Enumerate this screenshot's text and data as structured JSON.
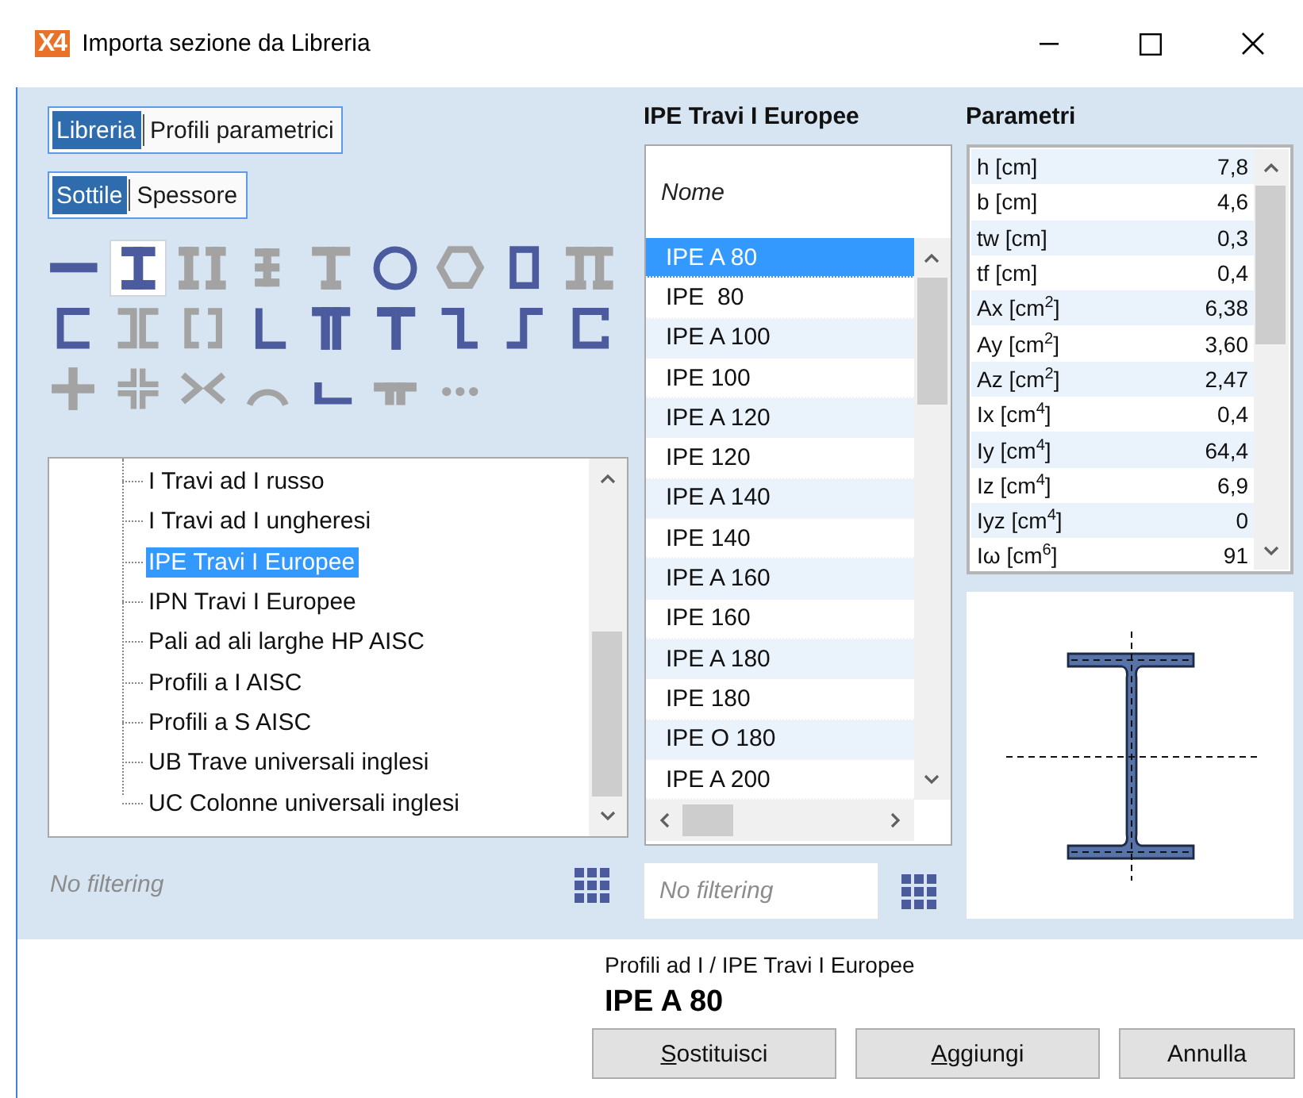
{
  "window": {
    "logo": "X4",
    "title": "Importa sezione da Libreria"
  },
  "source_tabs": [
    {
      "label": "Libreria",
      "selected": true
    },
    {
      "label": "Profili parametrici",
      "selected": false
    }
  ],
  "thickness_tabs": [
    {
      "label": "Sottile",
      "selected": true
    },
    {
      "label": "Spessore",
      "selected": false
    }
  ],
  "shapes": [
    {
      "kind": "plate",
      "disabled": false,
      "selected": false
    },
    {
      "kind": "i-beam",
      "disabled": false,
      "selected": true
    },
    {
      "kind": "double-i",
      "disabled": true,
      "selected": false
    },
    {
      "kind": "stiffened-i",
      "disabled": true,
      "selected": false
    },
    {
      "kind": "narrow-i",
      "disabled": true,
      "selected": false
    },
    {
      "kind": "circle",
      "disabled": false,
      "selected": false
    },
    {
      "kind": "hexagon",
      "disabled": true,
      "selected": false
    },
    {
      "kind": "box",
      "disabled": false,
      "selected": false
    },
    {
      "kind": "pi",
      "disabled": true,
      "selected": false
    },
    {
      "kind": "channel",
      "disabled": false,
      "selected": false
    },
    {
      "kind": "back-channels",
      "disabled": true,
      "selected": false
    },
    {
      "kind": "split-box",
      "disabled": true,
      "selected": false
    },
    {
      "kind": "angle",
      "disabled": false,
      "selected": false
    },
    {
      "kind": "double-tee",
      "disabled": false,
      "selected": false
    },
    {
      "kind": "tee",
      "disabled": false,
      "selected": false
    },
    {
      "kind": "zed",
      "disabled": false,
      "selected": false
    },
    {
      "kind": "ess",
      "disabled": false,
      "selected": false
    },
    {
      "kind": "lipped-channel",
      "disabled": false,
      "selected": false
    },
    {
      "kind": "cross",
      "disabled": true,
      "selected": false
    },
    {
      "kind": "cross-angles",
      "disabled": true,
      "selected": false
    },
    {
      "kind": "x-angles",
      "disabled": true,
      "selected": false
    },
    {
      "kind": "arc",
      "disabled": true,
      "selected": false
    },
    {
      "kind": "flat-channel",
      "disabled": false,
      "selected": false
    },
    {
      "kind": "low-double-tee",
      "disabled": true,
      "selected": false
    },
    {
      "kind": "more",
      "disabled": true,
      "selected": false
    }
  ],
  "tree": {
    "items": [
      {
        "label": "I Travi ad I russo",
        "selected": false
      },
      {
        "label": "I Travi ad I ungheresi",
        "selected": false
      },
      {
        "label": "IPE Travi I Europee",
        "selected": true
      },
      {
        "label": "IPN Travi I Europee",
        "selected": false
      },
      {
        "label": "Pali ad ali larghe HP AISC",
        "selected": false
      },
      {
        "label": "Profili a I AISC",
        "selected": false
      },
      {
        "label": "Profili a S AISC",
        "selected": false
      },
      {
        "label": "UB Trave universali inglesi",
        "selected": false
      },
      {
        "label": "UC Colonne universali inglesi",
        "selected": false
      }
    ],
    "filter": {
      "placeholder": "No filtering"
    }
  },
  "list": {
    "title": "IPE Travi I Europee",
    "column": "Nome",
    "rows": [
      {
        "name": "IPE A 80",
        "selected": true
      },
      {
        "name": "IPE  80",
        "selected": false
      },
      {
        "name": "IPE A 100",
        "selected": false
      },
      {
        "name": "IPE 100",
        "selected": false
      },
      {
        "name": "IPE A 120",
        "selected": false
      },
      {
        "name": "IPE 120",
        "selected": false
      },
      {
        "name": "IPE A 140",
        "selected": false
      },
      {
        "name": "IPE 140",
        "selected": false
      },
      {
        "name": "IPE A 160",
        "selected": false
      },
      {
        "name": "IPE 160",
        "selected": false
      },
      {
        "name": "IPE A 180",
        "selected": false
      },
      {
        "name": "IPE 180",
        "selected": false
      },
      {
        "name": "IPE O 180",
        "selected": false
      },
      {
        "name": "IPE A 200",
        "selected": false
      }
    ],
    "filter": {
      "placeholder": "No filtering"
    }
  },
  "parameters": {
    "title": "Parametri",
    "rows": [
      {
        "label": "h [cm]",
        "value": "7,8"
      },
      {
        "label": "b [cm]",
        "value": "4,6"
      },
      {
        "label": "tw [cm]",
        "value": "0,3"
      },
      {
        "label": "tf [cm]",
        "value": "0,4"
      },
      {
        "label": "Ax [cm$^{2}$]",
        "value": "6,38"
      },
      {
        "label": "Ay [cm$^{2}$]",
        "value": "3,60"
      },
      {
        "label": "Az [cm$^{2}$]",
        "value": "2,47"
      },
      {
        "label": "Ix [cm$^{4}$]",
        "value": "0,4"
      },
      {
        "label": "Iy [cm$^{4}$]",
        "value": "64,4"
      },
      {
        "label": "Iz [cm$^{4}$]",
        "value": "6,9"
      },
      {
        "label": "Iyz [cm$^{4}$]",
        "value": "0"
      },
      {
        "label": "Iω [cm$^{6}$]",
        "value": "91"
      }
    ]
  },
  "footer": {
    "path": "Profili ad I / IPE Travi I Europee",
    "selection": "IPE A 80",
    "buttons": [
      {
        "label": "Sostituisci",
        "underline_first": true
      },
      {
        "label": "Aggiungi",
        "underline_first": true
      },
      {
        "label": "Annulla",
        "underline_first": false
      }
    ]
  }
}
